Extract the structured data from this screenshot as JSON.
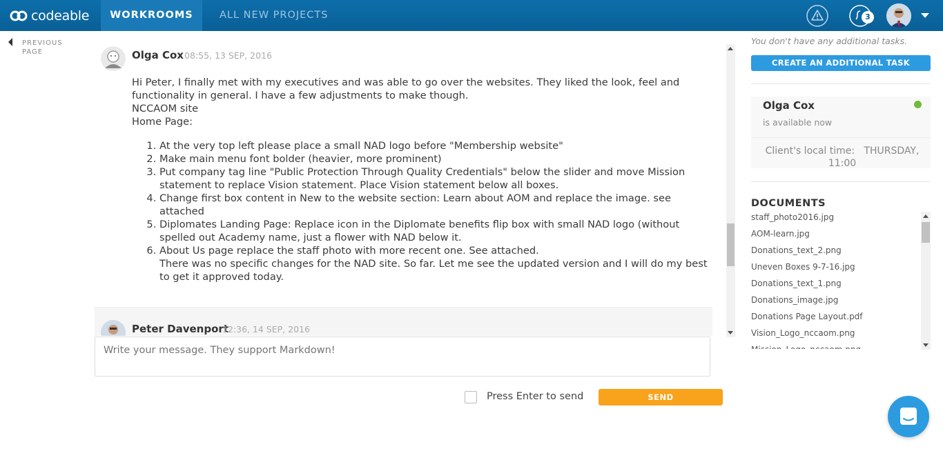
{
  "header": {
    "logo_text": "codeable",
    "tabs": [
      {
        "label": "WORKROOMS"
      },
      {
        "label": "ALL NEW PROJECTS"
      }
    ],
    "notification_count": "3",
    "icons": [
      "warning-icon",
      "bell-icon",
      "chevron-down-icon"
    ]
  },
  "prev_page": {
    "label": "PREVIOUS PAGE"
  },
  "messages": [
    {
      "author": "Olga Cox",
      "time": "08:55, 13 SEP, 2016",
      "intro_lines": [
        "Hi Peter, I finally met with my executives and was able to go over the websites. They liked the look, feel and functionality in general. I have a few adjustments to make though.",
        "NCCAOM site",
        "Home Page:"
      ],
      "items": [
        "At the very top left please place a small NAD logo before \"Membership website\"",
        "Make main menu font bolder (heavier, more prominent)",
        "Put company tag line \"Public Protection Through Quality Credentials\" below the slider and move Mission statement to replace Vision statement. Place Vision statement below all boxes.",
        "Change first box content in New to the website section: Learn about AOM and replace the image. see attached",
        "Diplomates Landing Page: Replace icon in the Diplomate benefits flip box with small NAD logo (without spelled out Academy name, just a flower with NAD below it.",
        "About Us page replace the staff photo with more recent one. See attached."
      ],
      "item6_extra": "There was no specific changes for the NAD site. So far. Let me see the updated version and I will do my best to get it approved today."
    },
    {
      "author": "Peter Davenport",
      "time": "12:36, 14 SEP, 2016"
    }
  ],
  "compose": {
    "placeholder": "Write your message. They support Markdown!",
    "enter_label": "Press Enter to send",
    "send_label": "SEND"
  },
  "sidebar": {
    "no_tasks": "You don't have any additional tasks.",
    "create_task_label": "CREATE AN ADDITIONAL TASK",
    "client": {
      "name": "Olga Cox",
      "status": "is available now",
      "local_time_label": "Client's local time:",
      "local_time_value": "THURSDAY, 11:00"
    },
    "documents_title": "DOCUMENTS",
    "documents": [
      "staff_photo2016.jpg",
      "AOM-learn.jpg",
      "Donations_text_2.png",
      "Uneven Boxes 9-7-16.jpg",
      "Donations_text_1.png",
      "Donations_image.jpg",
      "Donations Page Layout.pdf",
      "Vision_Logo_nccaom.png",
      "Mission_Logo_nccaom.png"
    ]
  },
  "colors": {
    "header_bg": "#0b68a3",
    "active_tab": "#1a7ab8",
    "accent_blue": "#2d9be0",
    "send_orange": "#f9a21b",
    "online_green": "#74b83e"
  }
}
